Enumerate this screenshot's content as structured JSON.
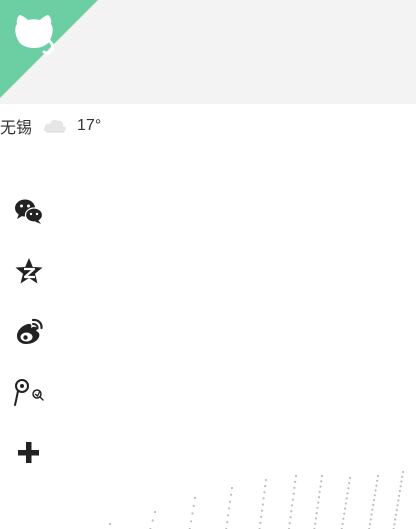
{
  "banner": {
    "logo_icon": "octocat-icon",
    "ribbon_color": "#6ccfa3",
    "background_color": "#f3f3f3"
  },
  "weather": {
    "city": "无锡",
    "condition_icon": "cloud-icon",
    "temperature": "17°"
  },
  "share": {
    "items": [
      {
        "name": "wechat",
        "icon": "wechat-icon"
      },
      {
        "name": "qzone",
        "icon": "qzone-icon"
      },
      {
        "name": "weibo",
        "icon": "weibo-icon"
      },
      {
        "name": "tencent-weibo",
        "icon": "tencent-weibo-icon"
      },
      {
        "name": "more",
        "icon": "plus-icon"
      }
    ],
    "icon_color": "#222222"
  }
}
